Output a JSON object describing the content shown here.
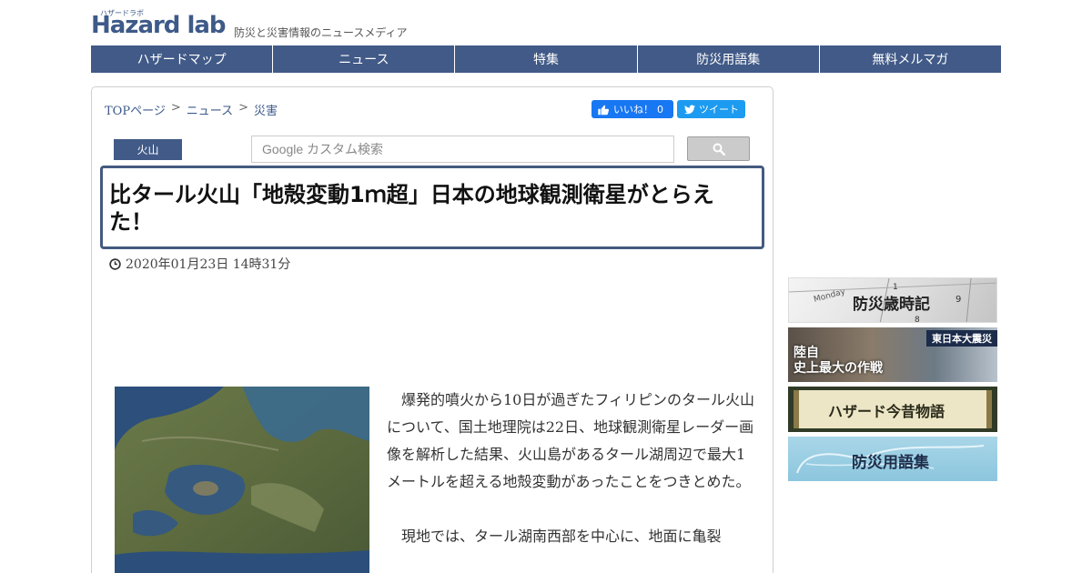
{
  "site": {
    "logo_kana": "ハザードラボ",
    "logo_text": "Hazard lab",
    "tagline": "防災と災害情報のニュースメディア"
  },
  "nav": [
    "ハザードマップ",
    "ニュース",
    "特集",
    "防災用語集",
    "無料メルマガ"
  ],
  "breadcrumb": {
    "items": [
      "TOPページ",
      "ニュース",
      "災害"
    ],
    "separator": ">"
  },
  "social": {
    "fb_label": "いいね！",
    "fb_count": "0",
    "tw_label": "ツイート"
  },
  "category": "火山",
  "search": {
    "placeholder": "Google カスタム検索"
  },
  "article": {
    "title": "比タール火山「地殻変動1ｍ超」日本の地球観測衛星がとらえた！",
    "date": "2020年01月23日 14時31分",
    "paragraphs": [
      "爆発的噴火から10日が過ぎたフィリピンのタール火山について、国土地理院は22日、地球観測衛星レーダー画像を解析した結果、火山島があるタール湖周辺で最大1メートルを超える地殻変動があったことをつきとめた。",
      "現地では、タール湖南西部を中心に、地面に亀裂"
    ]
  },
  "sidebar": {
    "banners": [
      {
        "label": "防災歳時記"
      },
      {
        "label_left": "陸自\n史上最大の作戦",
        "label_tag": "東日本大震災"
      },
      {
        "label": "ハザード今昔物語"
      },
      {
        "label": "防災用語集"
      }
    ]
  },
  "colors": {
    "nav_bg": "#415a87",
    "accent": "#445a80",
    "link": "#3d5a8a"
  }
}
